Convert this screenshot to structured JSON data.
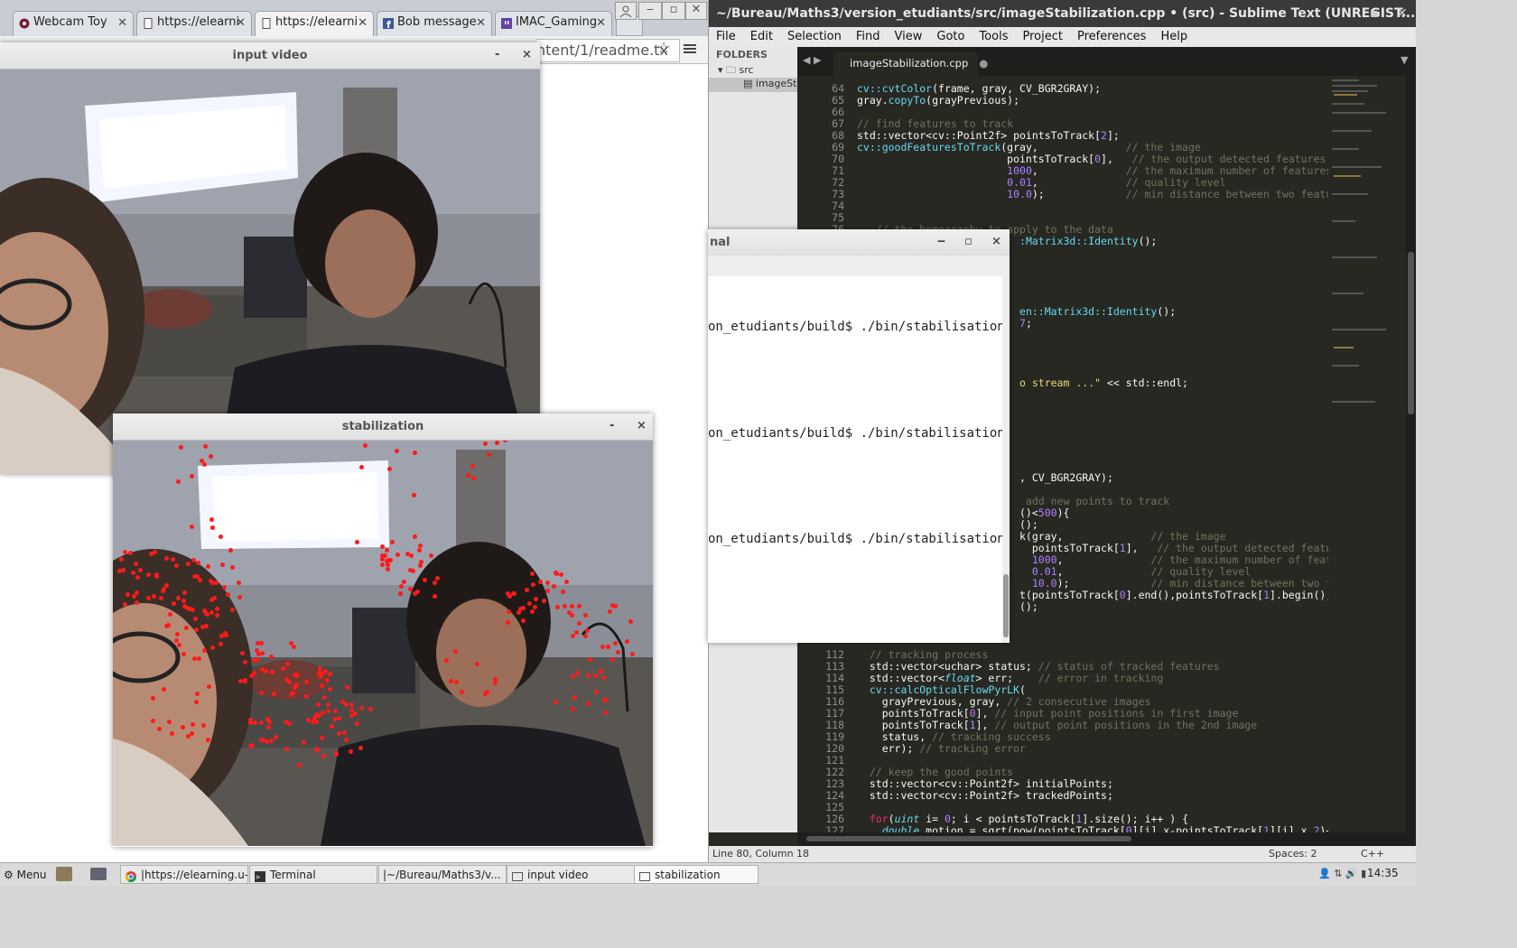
{
  "browser": {
    "tabs": [
      {
        "label": "Webcam Toy",
        "icon": "webcam-icon"
      },
      {
        "label": "https://elearni",
        "icon": "page-icon"
      },
      {
        "label": "https://elearni",
        "icon": "page-icon",
        "active": true
      },
      {
        "label": "Bob message",
        "icon": "facebook-icon"
      },
      {
        "label": "IMAC_Gaming",
        "icon": "twitch-icon"
      }
    ],
    "url_visible": "ntent/1/readme.tx",
    "menu_icon": "hamburger-icon",
    "star_icon": "star-icon"
  },
  "input_window": {
    "title": "input video",
    "minimize": "-",
    "close": "×"
  },
  "stab_window": {
    "title": "stabilization",
    "minimize": "-",
    "close": "×"
  },
  "terminal": {
    "title": "nal",
    "minimize": "‒",
    "maximize": "▫",
    "close": "×",
    "lines": [
      "on_etudiants/build$ ./bin/stabilisation",
      "on_etudiants/build$ ./bin/stabilisation",
      "on_etudiants/build$ ./bin/stabilisation"
    ]
  },
  "sublime": {
    "title": "~/Bureau/Maths3/version_etudiants/src/imageStabilization.cpp • (src) - Sublime Text (UNREGIST...",
    "menu": [
      "File",
      "Edit",
      "Selection",
      "Find",
      "View",
      "Goto",
      "Tools",
      "Project",
      "Preferences",
      "Help"
    ],
    "folders_label": "FOLDERS",
    "folder": "src",
    "file_item": "imageSt",
    "tab": "imageStabilization.cpp",
    "status_left": "Line 80, Column 18",
    "status_spaces": "Spaces: 2",
    "status_lang": "C++"
  },
  "taskbar": {
    "menu": "Menu",
    "tasks": [
      {
        "label": "|https://elearning.u-..."
      },
      {
        "label": "Terminal"
      },
      {
        "label": "|~/Bureau/Maths3/v..."
      },
      {
        "label": "input video"
      },
      {
        "label": "stabilization"
      }
    ],
    "clock": "14:35"
  }
}
